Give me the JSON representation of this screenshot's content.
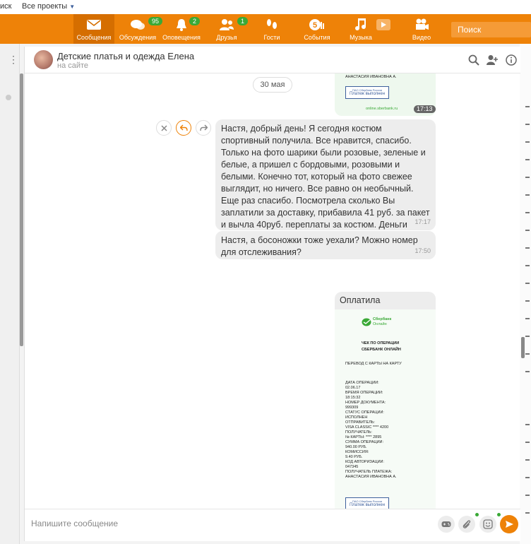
{
  "topbar": {
    "search_link": "иск",
    "all_projects": "Все проекты"
  },
  "nav": {
    "items": [
      {
        "label": "Сообщения",
        "badge": ""
      },
      {
        "label": "Обсуждения",
        "badge": "95"
      },
      {
        "label": "Оповещения",
        "badge": "2"
      },
      {
        "label": "Друзья",
        "badge": "1"
      },
      {
        "label": "Гости",
        "badge": ""
      },
      {
        "label": "События",
        "badge": "5"
      },
      {
        "label": "Музыка",
        "badge": ""
      },
      {
        "label": "Видео",
        "badge": ""
      }
    ],
    "search_placeholder": "Поиск"
  },
  "chat": {
    "title": "Детские платья и одежда Елена",
    "status": "на сайте",
    "date_separator": "30 мая",
    "messages": [
      {
        "text": "Настя, добрый день! Я сегодня костюм спортивный получила. Все нравится, спасибо. Только на фото шарики были розовые, зеленые и белые, а пришел с бордовыми, розовыми и белыми. Конечно тот, который на фото свежее выглядит, но ничего. Все равно он необычный. Еще раз спасибо. Посмотрела сколько Вы заплатили за доставку, прибавила 41 руб. за пакет и вычла 40руб. переплаты за костюм. Деньги перевела.",
        "time": "17:17"
      },
      {
        "text": "Настя, а босоножки тоже уехали? Можно номер для отслеживания?",
        "time": "17:50"
      }
    ],
    "top_receipt": {
      "recipient_name": "АНАСТАСИЯ ИВАНОВНА А.",
      "stamp_small": "ПАО Сбербанк России",
      "stamp_main": "Платеж выполнен",
      "site": "online.sberbank.ru",
      "time": "17:13"
    },
    "paid_message": {
      "caption": "Оплатила",
      "bank_name_1": "Сбербанк",
      "bank_name_2": "Онлайн",
      "heading_1": "ЧЕК ПО ОПЕРАЦИИ",
      "heading_2": "СБЕРБАНК ОНЛАЙН",
      "operation": "ПЕРЕВОД С КАРТЫ НА КАРТУ",
      "lines": [
        "ДАТА ОПЕРАЦИИ:",
        "02.06.17",
        "ВРЕМЯ ОПЕРАЦИИ:",
        "18:15:32",
        "НОМЕР ДОКУМЕНТА:",
        "999309",
        "СТАТУС ОПЕРАЦИИ:",
        "ИСПОЛНЕН",
        "ОТПРАВИТЕЛЬ:",
        "VISA CLASSIC **** 4200",
        "ПОЛУЧАТЕЛЬ:",
        "№ КАРТЫ: **** 2895",
        "СУММА ОПЕРАЦИИ:",
        "940.00 РУБ.",
        "КОМИССИЯ:",
        "9.40 РУБ.",
        "КОД АВТОРИЗАЦИИ:",
        "047345",
        "ПОЛУЧАТЕЛЬ ПЛАТЕЖА:",
        "АНАСТАСИЯ ИВАНОВНА А."
      ],
      "stamp_small": "ПАО Сбербанк России",
      "stamp_main": "Платеж выполнен"
    },
    "composer_placeholder": "Напишите сообщение"
  },
  "colors": {
    "brand": "#ee8208",
    "badge": "#3aa936"
  }
}
